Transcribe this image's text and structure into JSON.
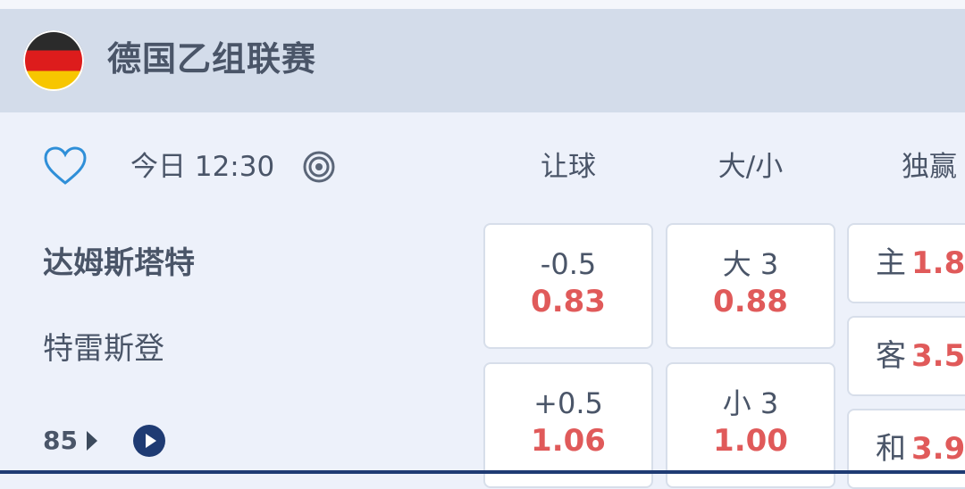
{
  "league": {
    "name": "德国乙组联赛",
    "flag": "germany-flag"
  },
  "match": {
    "time": "今日 12:30",
    "home_team": "达姆斯塔特",
    "away_team": "特雷斯登",
    "minute": "85"
  },
  "columns": [
    "让球",
    "大/小",
    "独赢"
  ],
  "handicap": [
    {
      "line": "-0.5",
      "price": "0.83"
    },
    {
      "line": "+0.5",
      "price": "1.06"
    }
  ],
  "over_under": [
    {
      "line": "大 3",
      "price": "0.88"
    },
    {
      "line": "小 3",
      "price": "1.00"
    }
  ],
  "moneyline": [
    {
      "label": "主",
      "price": "1.8"
    },
    {
      "label": "客",
      "price": "3.5"
    },
    {
      "label": "和",
      "price": "3.9"
    }
  ],
  "colors": {
    "price": "#e05a5a",
    "header_bg": "#d3dcea",
    "bg": "#edf1fa",
    "accent": "#1f3b73"
  }
}
